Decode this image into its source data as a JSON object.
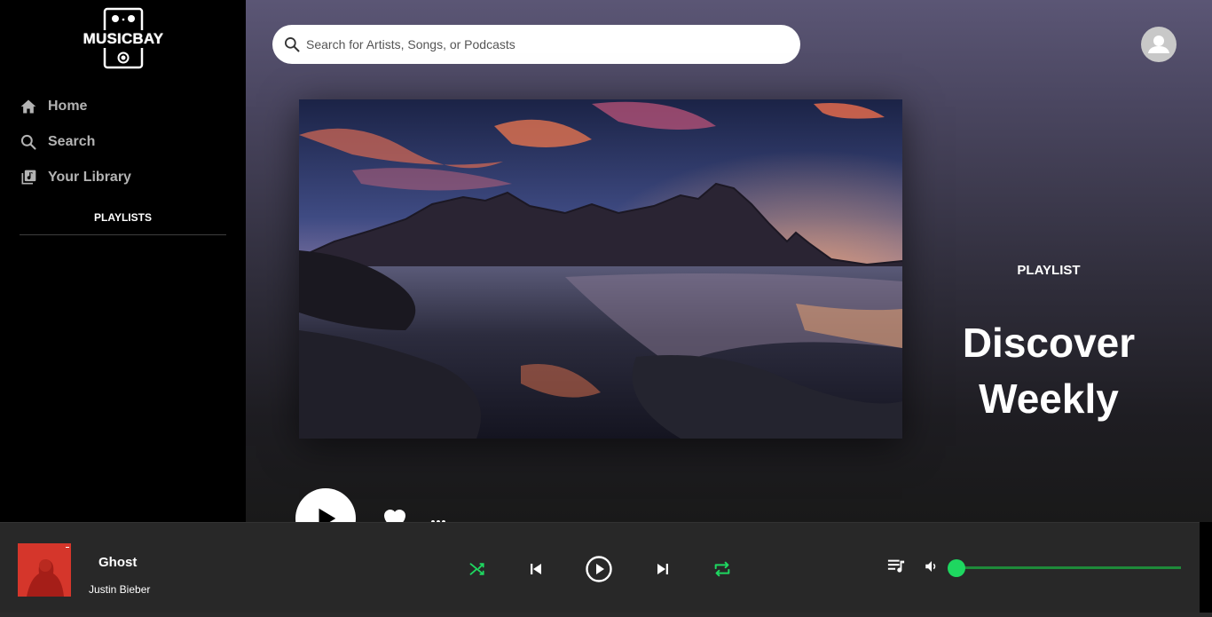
{
  "brand": {
    "name": "MUSICBAY"
  },
  "sidebar": {
    "nav": [
      {
        "label": "Home",
        "icon": "home-icon"
      },
      {
        "label": "Search",
        "icon": "search-icon"
      },
      {
        "label": "Your Library",
        "icon": "library-icon"
      }
    ],
    "playlists_title": "PLAYLISTS"
  },
  "header": {
    "search_placeholder": "Search for Artists, Songs, or Podcasts",
    "avatar_icon": "user-icon"
  },
  "playlist": {
    "kind": "PLAYLIST",
    "title_line1": "Discover",
    "title_line2": "Weekly"
  },
  "player": {
    "song_title": "Ghost",
    "artist": "Justin Bieber",
    "volume_level": 0.0,
    "accent_color": "#1ed760",
    "controls": [
      "shuffle-icon",
      "previous-icon",
      "play-icon",
      "next-icon",
      "repeat-icon",
      "queue-icon",
      "volume-icon"
    ]
  }
}
